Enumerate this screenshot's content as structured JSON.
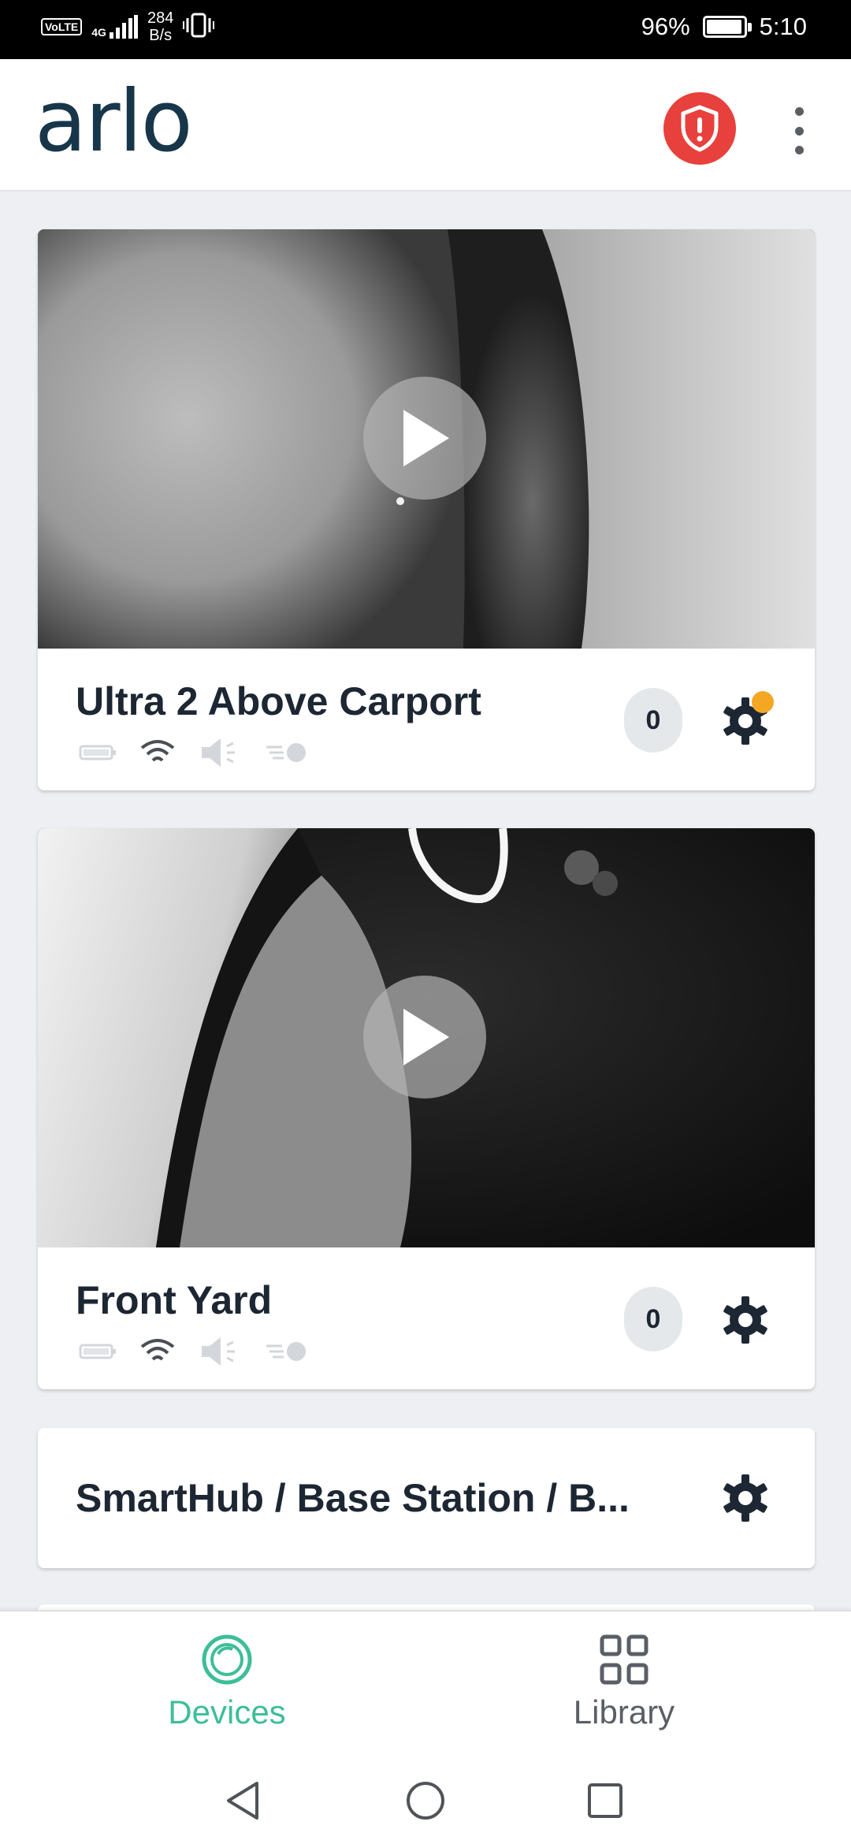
{
  "status_bar": {
    "volte": "VoLTE",
    "network": "4G",
    "speed_value": "284",
    "speed_unit": "B/s",
    "battery_percent": "96%",
    "battery_level": 0.96,
    "time": "5:10"
  },
  "app_bar": {
    "logo": "arlo",
    "shield_icon": "shield-alert-icon",
    "more_icon": "more-vertical-icon",
    "shield_color": "#e8403c"
  },
  "cameras": [
    {
      "name": "Ultra 2 Above Carport",
      "clip_count": "0",
      "settings_alert": true,
      "alert_color": "#f5a623"
    },
    {
      "name": "Front Yard",
      "clip_count": "0",
      "settings_alert": false
    }
  ],
  "hub": {
    "name": "SmartHub / Base Station / B..."
  },
  "bottom_nav": {
    "devices_label": "Devices",
    "library_label": "Library",
    "active": "Devices",
    "accent_color": "#3dbe99"
  }
}
